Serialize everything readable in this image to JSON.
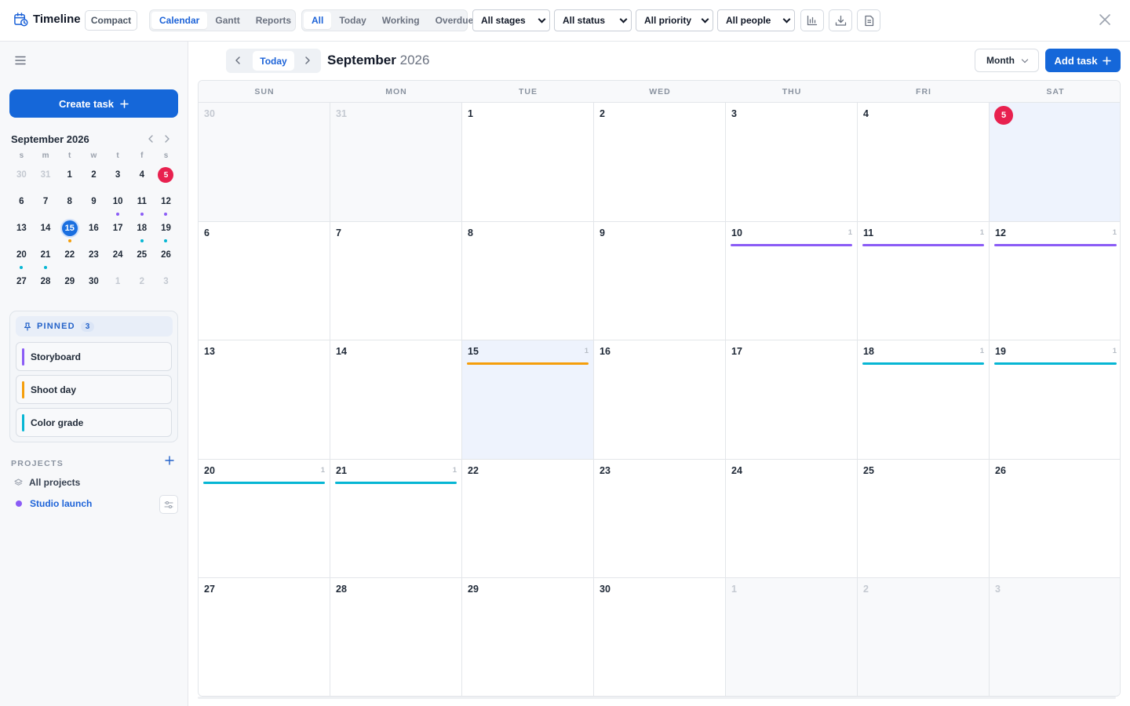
{
  "app": {
    "title": "Timeline",
    "compact_label": "Compact"
  },
  "view_tabs": [
    "Calendar",
    "Gantt",
    "Reports"
  ],
  "active_view_tab": 0,
  "filter_tabs": [
    "All",
    "Today",
    "Working",
    "Overdue"
  ],
  "active_filter_tab": 0,
  "filters": {
    "stages": "All stages",
    "status": "All status",
    "priority": "All priority",
    "people": "All people"
  },
  "icons": {
    "brand": "calendar-clock-icon",
    "stats": "bar-chart-icon",
    "download": "download-icon",
    "doc": "document-icon",
    "close": "close-icon",
    "menu": "hamburger-menu-icon",
    "pin": "pin-icon",
    "layers": "layers-icon",
    "settings": "sliders-icon",
    "plus": "plus-icon"
  },
  "sidebar": {
    "create_label": "Create task",
    "mini_calendar": {
      "title": "September 2026",
      "weekday_labels": [
        "s",
        "m",
        "t",
        "w",
        "t",
        "f",
        "s"
      ],
      "weeks": [
        [
          {
            "d": "30",
            "muted": true
          },
          {
            "d": "31",
            "muted": true
          },
          {
            "d": "1"
          },
          {
            "d": "2"
          },
          {
            "d": "3"
          },
          {
            "d": "4"
          },
          {
            "d": "5",
            "today": true
          }
        ],
        [
          {
            "d": "6"
          },
          {
            "d": "7"
          },
          {
            "d": "8"
          },
          {
            "d": "9"
          },
          {
            "d": "10",
            "dot": "#8b5cf6"
          },
          {
            "d": "11",
            "dot": "#8b5cf6"
          },
          {
            "d": "12",
            "dot": "#8b5cf6"
          }
        ],
        [
          {
            "d": "13"
          },
          {
            "d": "14"
          },
          {
            "d": "15",
            "selected": true,
            "dot": "#f59e0b"
          },
          {
            "d": "16"
          },
          {
            "d": "17"
          },
          {
            "d": "18",
            "dot": "#06b6d4"
          },
          {
            "d": "19",
            "dot": "#06b6d4"
          }
        ],
        [
          {
            "d": "20",
            "dot": "#06b6d4"
          },
          {
            "d": "21",
            "dot": "#06b6d4"
          },
          {
            "d": "22"
          },
          {
            "d": "23"
          },
          {
            "d": "24"
          },
          {
            "d": "25"
          },
          {
            "d": "26"
          }
        ],
        [
          {
            "d": "27"
          },
          {
            "d": "28"
          },
          {
            "d": "29"
          },
          {
            "d": "30"
          },
          {
            "d": "1",
            "muted": true
          },
          {
            "d": "2",
            "muted": true
          },
          {
            "d": "3",
            "muted": true
          }
        ]
      ]
    },
    "pinned": {
      "label": "PINNED",
      "count": "3",
      "items": [
        {
          "label": "Storyboard",
          "color": "#8b5cf6"
        },
        {
          "label": "Shoot day",
          "color": "#f59e0b"
        },
        {
          "label": "Color grade",
          "color": "#06b6d4"
        }
      ]
    },
    "projects": {
      "label": "PROJECTS",
      "all_label": "All projects",
      "items": [
        {
          "label": "Studio launch",
          "color": "#8b5cf6"
        }
      ]
    }
  },
  "calendar": {
    "today_label": "Today",
    "month": "September",
    "year": "2026",
    "view_label": "Month",
    "add_label": "Add task",
    "weekdays": [
      "SUN",
      "MON",
      "TUE",
      "WED",
      "THU",
      "FRI",
      "SAT"
    ],
    "weeks": [
      [
        {
          "d": "30",
          "outside": true
        },
        {
          "d": "31",
          "outside": true
        },
        {
          "d": "1"
        },
        {
          "d": "2"
        },
        {
          "d": "3"
        },
        {
          "d": "4"
        },
        {
          "d": "5",
          "today": true,
          "highlight": true
        }
      ],
      [
        {
          "d": "6"
        },
        {
          "d": "7"
        },
        {
          "d": "8"
        },
        {
          "d": "9"
        },
        {
          "d": "10",
          "count": "1",
          "color": "#8b5cf6"
        },
        {
          "d": "11",
          "count": "1",
          "color": "#8b5cf6"
        },
        {
          "d": "12",
          "count": "1",
          "color": "#8b5cf6"
        }
      ],
      [
        {
          "d": "13"
        },
        {
          "d": "14"
        },
        {
          "d": "15",
          "count": "1",
          "color": "#f59e0b",
          "highlight": true
        },
        {
          "d": "16"
        },
        {
          "d": "17"
        },
        {
          "d": "18",
          "count": "1",
          "color": "#06b6d4"
        },
        {
          "d": "19",
          "count": "1",
          "color": "#06b6d4"
        }
      ],
      [
        {
          "d": "20",
          "count": "1",
          "color": "#06b6d4"
        },
        {
          "d": "21",
          "count": "1",
          "color": "#06b6d4"
        },
        {
          "d": "22"
        },
        {
          "d": "23"
        },
        {
          "d": "24"
        },
        {
          "d": "25"
        },
        {
          "d": "26"
        }
      ],
      [
        {
          "d": "27"
        },
        {
          "d": "28"
        },
        {
          "d": "29"
        },
        {
          "d": "30"
        },
        {
          "d": "1",
          "outside": true
        },
        {
          "d": "2",
          "outside": true
        },
        {
          "d": "3",
          "outside": true
        }
      ]
    ]
  },
  "colors": {
    "accent": "#1567d9",
    "today": "#e8214f",
    "storyboard": "#8b5cf6",
    "shoot": "#f59e0b",
    "grade": "#06b6d4"
  }
}
